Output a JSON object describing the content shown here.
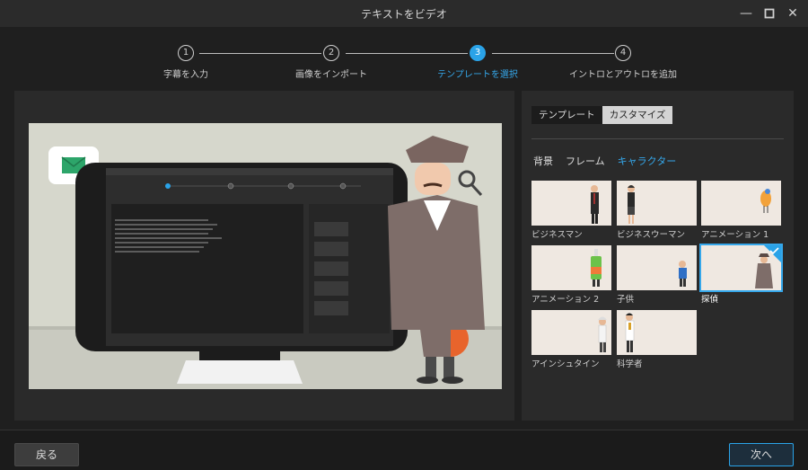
{
  "window": {
    "title": "テキストをビデオ",
    "minimize": "—",
    "maximize": "□",
    "close": "✕"
  },
  "steps": [
    {
      "num": "1",
      "label": "字幕を入力"
    },
    {
      "num": "2",
      "label": "画像をインポート"
    },
    {
      "num": "3",
      "label": "テンプレートを選択"
    },
    {
      "num": "4",
      "label": "イントロとアウトロを追加"
    }
  ],
  "panel": {
    "tabs": [
      "テンプレート",
      "カスタマイズ"
    ],
    "subtabs": [
      "背景",
      "フレーム",
      "キャラクター"
    ],
    "characters": [
      {
        "label": "ビジネスマン"
      },
      {
        "label": "ビジネスウーマン"
      },
      {
        "label": "アニメーション 1"
      },
      {
        "label": "アニメーション 2"
      },
      {
        "label": "子供"
      },
      {
        "label": "探偵"
      },
      {
        "label": "アインシュタイン"
      },
      {
        "label": "科学者"
      }
    ]
  },
  "buttons": {
    "back": "戻る",
    "next": "次へ"
  },
  "colors": {
    "accent": "#2aa3e8",
    "background": "#1f1f1f",
    "panel": "#2a2a2a"
  }
}
